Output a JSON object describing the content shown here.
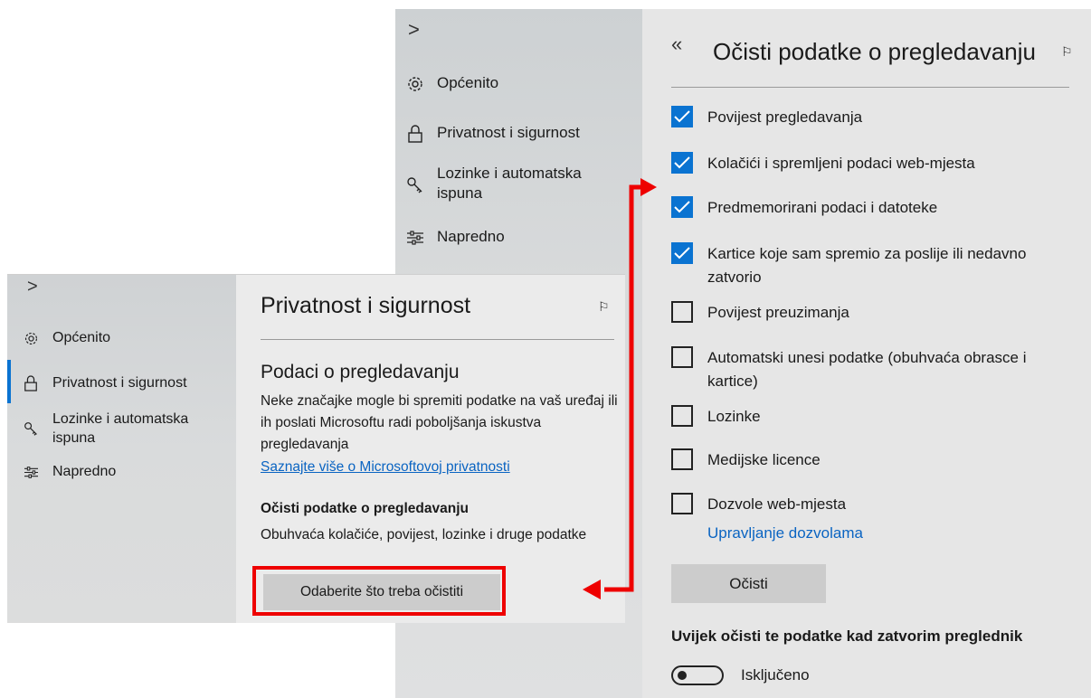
{
  "back_panel": {
    "nav": {
      "chevron": ">",
      "items": [
        {
          "icon": "gear-icon",
          "label": "Općenito"
        },
        {
          "icon": "lock-icon",
          "label": "Privatnost i sigurnost"
        },
        {
          "icon": "key-icon",
          "label": "Lozinke i automatska ispuna"
        },
        {
          "icon": "sliders-icon",
          "label": "Napredno"
        }
      ]
    },
    "header": {
      "back_glyph": "«",
      "title": "Očisti podatke o pregledavanju"
    },
    "options": [
      {
        "label": "Povijest pregledavanja",
        "checked": true
      },
      {
        "label": "Kolačići i spremljeni podaci web-mjesta",
        "checked": true
      },
      {
        "label": "Predmemorirani podaci i datoteke",
        "checked": true
      },
      {
        "label": "Kartice koje sam spremio za poslije ili nedavno zatvorio",
        "checked": true
      },
      {
        "label": "Povijest preuzimanja",
        "checked": false
      },
      {
        "label": "Automatski unesi podatke (obuhvaća obrasce i kartice)",
        "checked": false
      },
      {
        "label": "Lozinke",
        "checked": false
      },
      {
        "label": "Medijske licence",
        "checked": false
      },
      {
        "label": "Dozvole web-mjesta",
        "checked": false
      }
    ],
    "manage_permissions_link": "Upravljanje dozvolama",
    "clear_button": "Očisti",
    "always_clear_label": "Uvijek očisti te podatke kad zatvorim preglednik",
    "toggle_state": "Isključeno"
  },
  "front_panel": {
    "nav": {
      "chevron": ">",
      "items": [
        {
          "icon": "gear-icon",
          "label": "Općenito"
        },
        {
          "icon": "lock-icon",
          "label": "Privatnost i sigurnost"
        },
        {
          "icon": "key-icon",
          "label": "Lozinke i automatska ispuna"
        },
        {
          "icon": "sliders-icon",
          "label": "Napredno"
        }
      ]
    },
    "title": "Privatnost i sigurnost",
    "section_title": "Podaci o pregledavanju",
    "section_desc": "Neke značajke mogle bi spremiti podatke na vaš uređaj ili ih poslati Microsoftu radi poboljšanja iskustva pregledavanja",
    "privacy_link": "Saznajte više o Microsoftovoj privatnosti",
    "clear_heading": "Očisti podatke o pregledavanju",
    "clear_desc": "Obuhvaća kolačiće, povijest, lozinke i druge podatke",
    "choose_button": "Odaberite što treba očistiti"
  },
  "colors": {
    "accent": "#0a73d1",
    "highlight": "#ee0000",
    "link": "#0a64c2"
  }
}
